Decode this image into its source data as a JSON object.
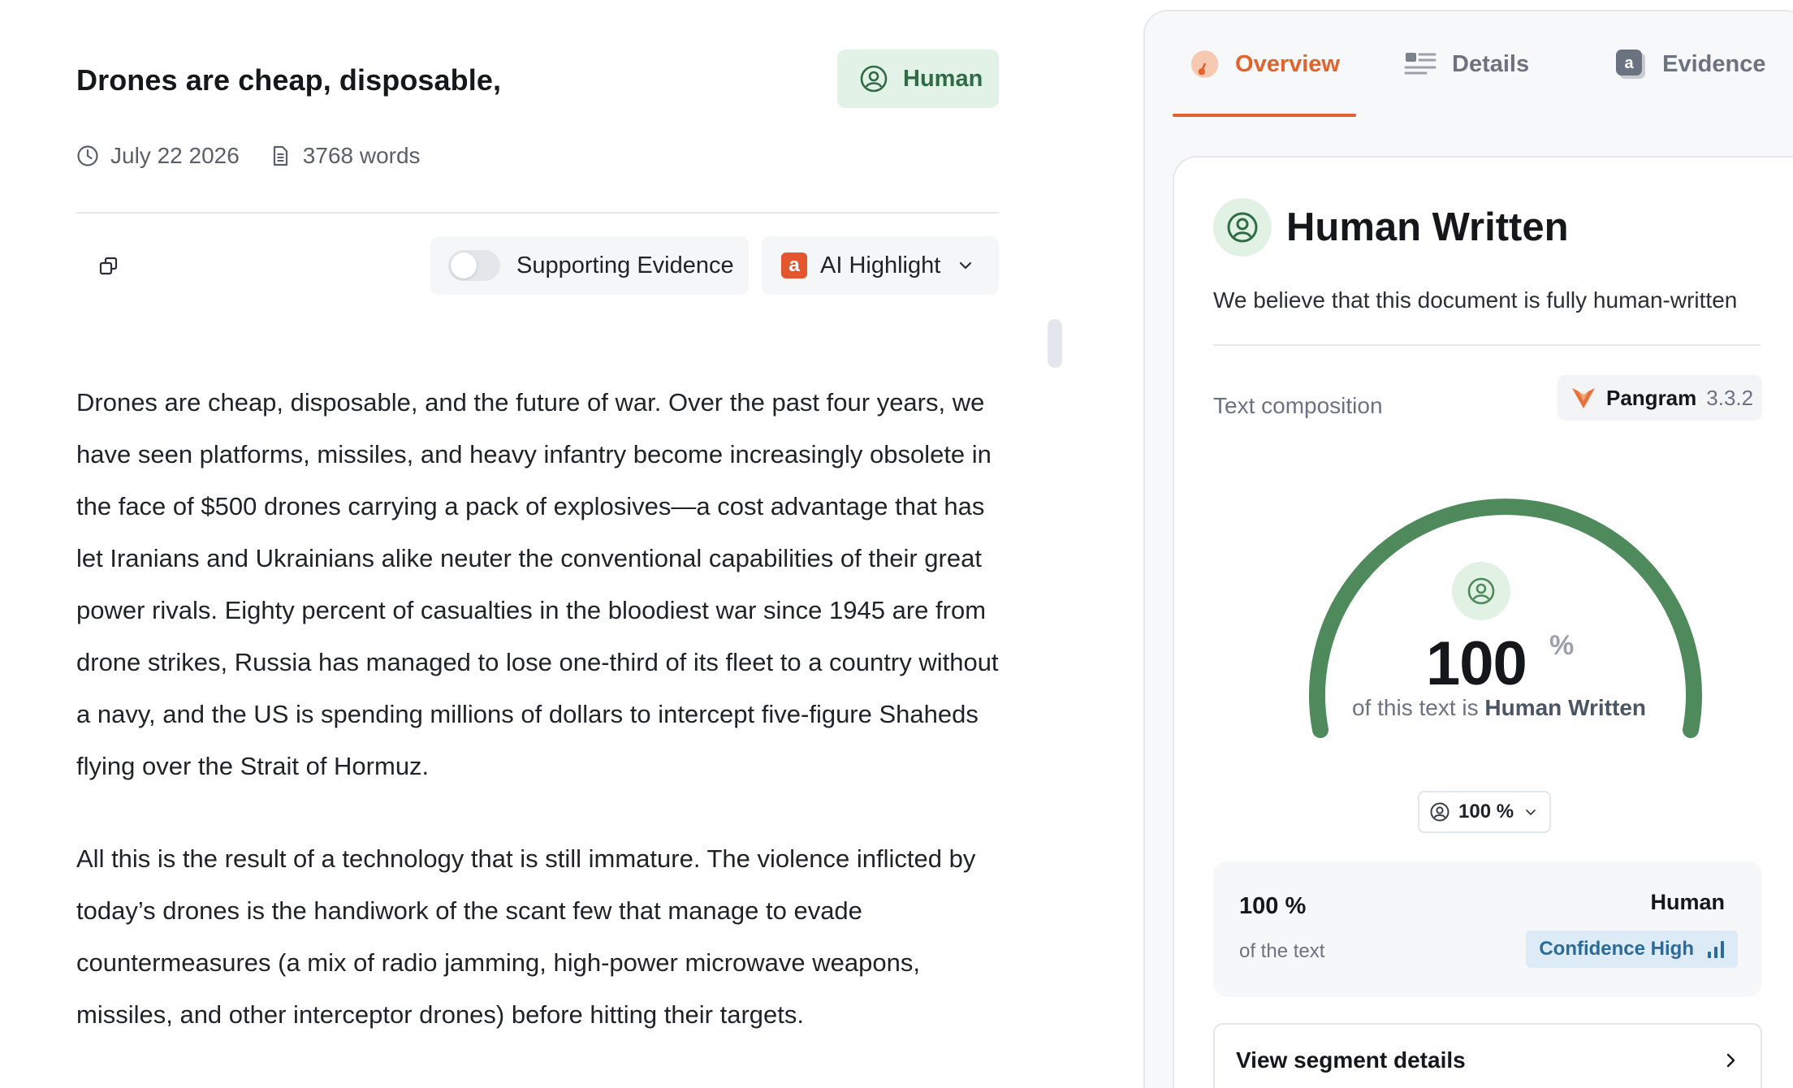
{
  "document": {
    "title": "Drones are cheap, disposable,",
    "verdict_badge": "Human",
    "date": "July 22 2026",
    "word_count": "3768 words",
    "toolbar": {
      "supporting_evidence_label": "Supporting Evidence",
      "supporting_evidence_on": false,
      "ai_highlight_label": "AI Highlight",
      "ai_highlight_chip": "a"
    },
    "paragraphs": [
      "Drones are cheap, disposable, and the future of war. Over the past four years, we have seen platforms, missiles, and heavy infantry become increasingly obsolete in the face of $500 drones carrying a pack of explosives—a cost advantage that has let Iranians and Ukrainians alike neuter the conventional capabilities of their great power rivals. Eighty percent of casualties in the bloodiest war since 1945 are from drone strikes, Russia has managed to lose one-third of its fleet to a country without a navy, and the US is spending millions of dollars to intercept five-figure Shaheds flying over the Strait of Hormuz.",
      "All this is the result of a technology that is still immature. The violence inflicted by today’s drones is the handiwork of the scant few that manage to evade countermeasures (a mix of radio jamming, high-power microwave weapons, missiles, and other interceptor drones) before hitting their targets."
    ]
  },
  "panel": {
    "tabs": [
      {
        "label": "Overview",
        "active": true
      },
      {
        "label": "Details",
        "active": false
      },
      {
        "label": "Evidence",
        "active": false,
        "chip": "a"
      }
    ],
    "verdict_title": "Human Written",
    "verdict_subtitle": "We believe that this document is fully human-written",
    "composition_label": "Text composition",
    "model_name": "Pangram",
    "model_version": "3.3.2",
    "gauge": {
      "value": "100",
      "unit": "%",
      "caption_prefix": "of this text is ",
      "caption_bold": "Human Written",
      "fill_fraction": 1.0,
      "color": "#4e8a5b"
    },
    "select_value": "100 %",
    "stat": {
      "percent": "100 %",
      "of_text": "of the text",
      "label": "Human",
      "confidence": "Confidence High"
    },
    "segment_button": "View segment details"
  },
  "colors": {
    "accent": "#e0642e",
    "human_green": "#4e8a5b",
    "human_bg": "#e3f2e6",
    "confidence_blue": "#2c6a9a"
  },
  "icons": [
    "person-circle-icon",
    "clock-icon",
    "document-icon",
    "copy-icon",
    "chevron-down-icon",
    "gauge-icon",
    "list-icon",
    "pangram-logo-icon",
    "bar-chart-icon",
    "chevron-right-icon"
  ]
}
